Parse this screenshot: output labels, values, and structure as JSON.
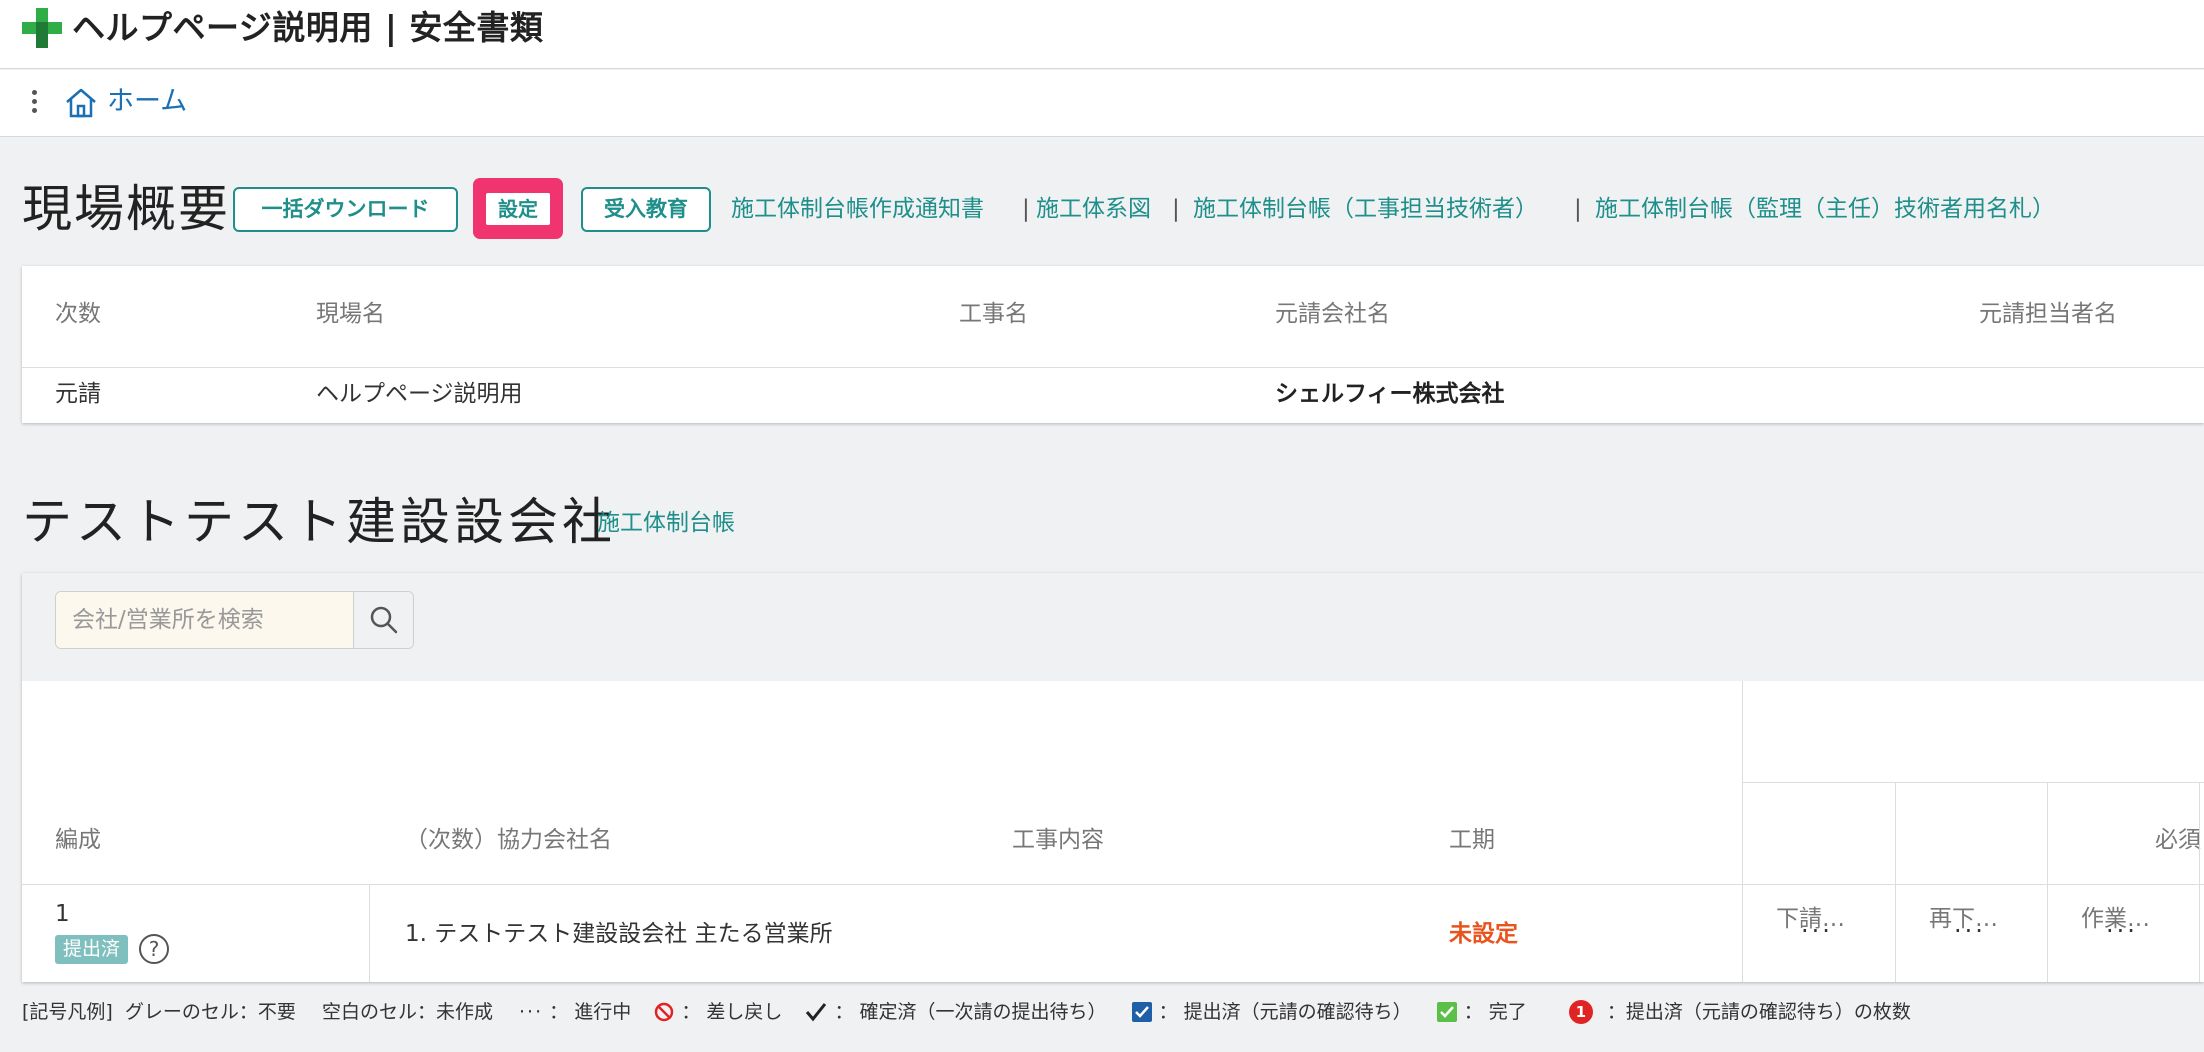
{
  "app": {
    "title": "ヘルプページ説明用 | 安全書類"
  },
  "nav": {
    "home": "ホーム"
  },
  "overview": {
    "title": "現場概要",
    "buttons": {
      "download": "一括ダウンロード",
      "settings": "設定",
      "education": "受入教育"
    },
    "links": [
      "施工体制台帳作成通知書",
      "施工体系図",
      "施工体制台帳（工事担当技術者）",
      "施工体制台帳（監理（主任）技術者用名札）"
    ],
    "separator": "|",
    "table": {
      "headers": [
        "次数",
        "現場名",
        "工事名",
        "元請会社名",
        "元請担当者名"
      ],
      "row": [
        "元請",
        "ヘルプページ説明用",
        "",
        "シェルフィー株式会社",
        ""
      ]
    }
  },
  "company": {
    "title": "テストテスト建設設会社",
    "link": "施工体制台帳",
    "search": {
      "placeholder": "会社/営業所を検索"
    },
    "table": {
      "headers": {
        "formation": "編成",
        "partner": "（次数）協力会社名",
        "content": "工事内容",
        "period": "工期",
        "required": "必須"
      },
      "subheaders": [
        "下請…",
        "再下…",
        "作業…"
      ],
      "row": {
        "number": "1",
        "status": "提出済",
        "company": "1. テストテスト建設設会社 主たる営業所",
        "period": "未設定",
        "cells": [
          "···",
          "···",
          "···"
        ]
      }
    }
  },
  "legend": {
    "title": "[記号凡例]",
    "gray": "グレーのセル：不要",
    "blank": "空白のセル：未作成",
    "progress_symbol": "···",
    "progress": "：  進行中",
    "rejected": "：  差し戻し",
    "confirmed": "：  確定済（一次請の提出待ち）",
    "submitted": "：  提出済（元請の確認待ち）",
    "complete": "：  完了",
    "count_symbol": "1",
    "count": "：提出済（元請の確認待ち）の枚数"
  },
  "colors": {
    "teal": "#1e8f8a",
    "pink": "#f0346f",
    "orange": "#e8541e",
    "blue": "#1a6fb5"
  }
}
